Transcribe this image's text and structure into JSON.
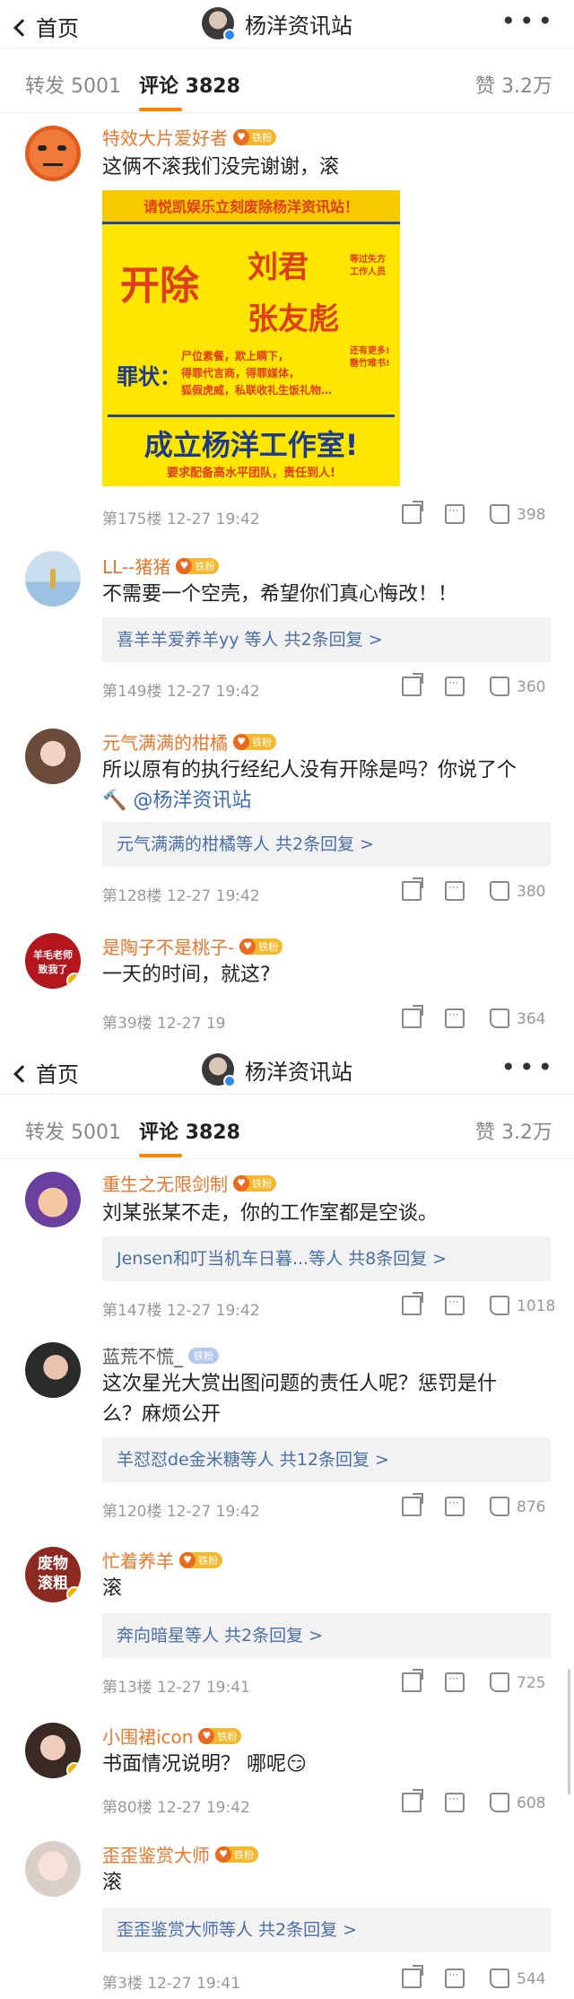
{
  "header": {
    "back_label": "首页",
    "title": "杨洋资讯站"
  },
  "tabs": {
    "repost": "转发 5001",
    "comment": "评论 3828",
    "like": "赞 3.2万"
  },
  "fan_label": "铁粉",
  "comments_top": [
    {
      "user": "特效大片爱好者",
      "text": "这俩不滚我们没完谢谢，滚",
      "floor": "第175楼 12-27 19:42",
      "likes": "398",
      "poster": {
        "header": "请悦凯娱乐立刻废除杨洋资讯站！",
        "fire": "开除",
        "name1": "刘君",
        "name2": "张友彪",
        "note1": "等过失方",
        "note2": "工作人员",
        "crime_label": "罪状：",
        "crimes": [
          "尸位素餐，欺上瞒下，",
          "得罪代言商，得罪媒体，",
          "狐假虎威，私联收礼生饭礼物…"
        ],
        "more1": "还有更多!",
        "more2": "罄竹难书!",
        "studio": "成立杨洋工作室!",
        "demand": "要求配备高水平团队，责任到人!"
      }
    },
    {
      "user": "LL--猪猪",
      "text": "不需要一个空壳，希望你们真心悔改！！",
      "replies": "喜羊羊爱养羊yy 等人  共2条回复 >",
      "floor": "第149楼 12-27 19:42",
      "likes": "360"
    },
    {
      "user": "元气满满的柑橘",
      "text": "所以原有的执行经纪人没有开除是吗？你说了个",
      "text2": "🔨 ",
      "mention": "@杨洋资讯站",
      "replies": "元气满满的柑橘等人  共2条回复 >",
      "floor": "第128楼 12-27 19:42",
      "likes": "380"
    },
    {
      "user": "是陶子不是桃子-",
      "text": "一天的时间，就这?",
      "avatar_text1": "羊毛老师",
      "avatar_text2": "致我了",
      "floor": "第39楼 12-27 19",
      "likes": "364"
    }
  ],
  "comments_bottom": [
    {
      "user": "重生之无限剑制",
      "text": "刘某张某不走，你的工作室都是空谈。",
      "replies": "Jensen和叮当机车日暮...等人  共8条回复 >",
      "floor": "第147楼 12-27 19:42",
      "likes": "1018"
    },
    {
      "user": "蓝荒不慌_",
      "text": "这次星光大赏出图问题的责任人呢？惩罚是什",
      "text2": "么？麻烦公开",
      "replies": "羊怼怼de金米糖等人  共12条回复 >",
      "floor": "第120楼 12-27 19:42",
      "likes": "876"
    },
    {
      "user": "忙着养羊",
      "text": "滚",
      "avatar_text1": "废物",
      "avatar_text2": "滚粗",
      "replies": "奔向暗星等人  共2条回复 >",
      "floor": "第13楼 12-27 19:41",
      "likes": "725"
    },
    {
      "user": "小围裙icon",
      "text": "书面情况说明？ 哪呢😏",
      "floor": "第80楼 12-27 19:42",
      "likes": "608"
    },
    {
      "user": "歪歪鉴赏大师",
      "text": "滚",
      "replies": "歪歪鉴赏大师等人  共2条回复 >",
      "floor": "第3楼 12-27 19:41",
      "likes": "544"
    }
  ]
}
